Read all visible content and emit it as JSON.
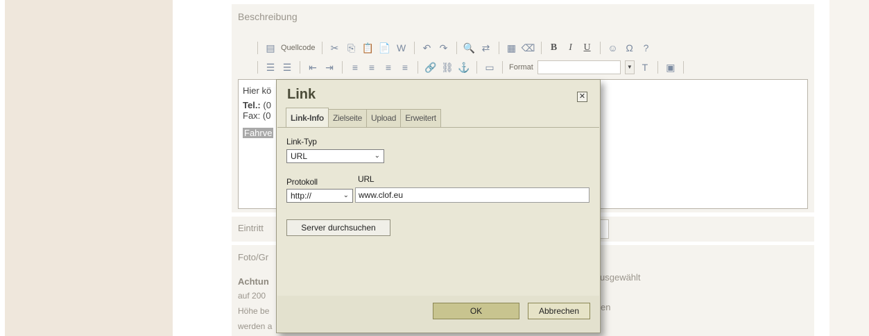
{
  "editor": {
    "section_label": "Beschreibung",
    "source_label": "Quellcode",
    "format_label": "Format",
    "content": {
      "line1": "Hier kö",
      "tel_label": "Tel.:",
      "tel_value": "(0",
      "fax_line": "Fax: (0",
      "selected_text": "Fahrve"
    }
  },
  "background": {
    "eintritt_label": "Eintritt",
    "foto_label": "Foto/Gr",
    "achtung": "Achtun",
    "line_auf": "auf 200",
    "line_hoehe": "Höhe be",
    "line_werden": "werden a",
    "ausgewaehlt": "usgewählt",
    "en_fragment": "en"
  },
  "dialog": {
    "title": "Link",
    "close_glyph": "✕",
    "tabs": [
      "Link-Info",
      "Zielseite",
      "Upload",
      "Erweitert"
    ],
    "link_type_label": "Link-Typ",
    "link_type_value": "URL",
    "protocol_label": "Protokoll",
    "protocol_value": "http://",
    "url_label": "URL",
    "url_value": "www.clof.eu",
    "browse_button": "Server durchsuchen",
    "ok_button": "OK",
    "cancel_button": "Abbrechen"
  }
}
